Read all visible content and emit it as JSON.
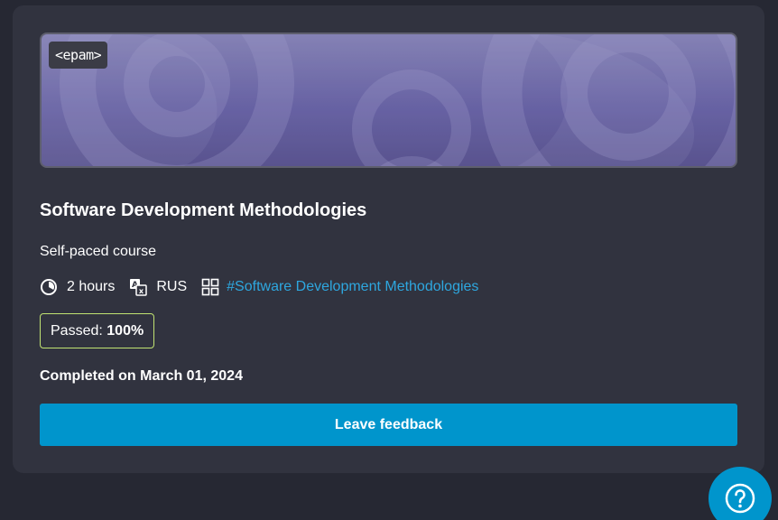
{
  "banner": {
    "logo_text": "<epam>"
  },
  "course": {
    "title": "Software Development Methodologies",
    "type": "Self-paced course",
    "duration": "2 hours",
    "language": "RUS",
    "tag": "#Software Development Methodologies"
  },
  "status": {
    "passed_label": "Passed:",
    "passed_value": "100%",
    "completed_text": "Completed on March 01, 2024"
  },
  "actions": {
    "feedback_label": "Leave feedback"
  },
  "icons": {
    "duration": "clock-icon",
    "language": "translate-icon",
    "tag": "grid-icon",
    "help": "question-mark-icon"
  },
  "colors": {
    "page_background": "#262833",
    "card_background": "#31333f",
    "accent": "#0095cc",
    "link": "#2ea7df",
    "passed_border": "#c1e372"
  }
}
